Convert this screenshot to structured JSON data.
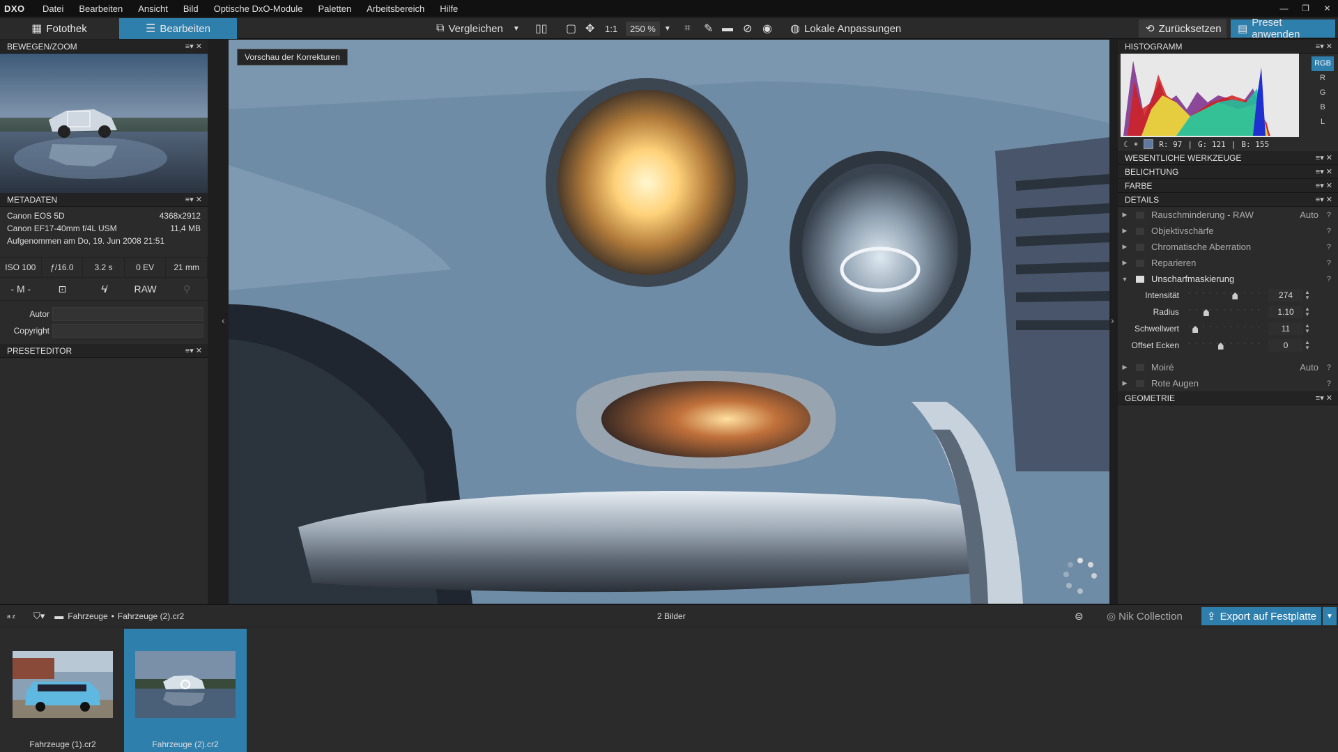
{
  "app": {
    "logo": "DXO"
  },
  "menu": [
    "Datei",
    "Bearbeiten",
    "Ansicht",
    "Bild",
    "Optische DxO-Module",
    "Paletten",
    "Arbeitsbereich",
    "Hilfe"
  ],
  "window_controls": [
    "—",
    "❐",
    "✕"
  ],
  "modes": {
    "library": "Fotothek",
    "edit": "Bearbeiten"
  },
  "toolbar": {
    "compare": "Vergleichen",
    "one_to_one": "1:1",
    "zoom": "250 %",
    "local_adjust": "Lokale Anpassungen",
    "reset": "Zurücksetzen",
    "apply_preset": "Preset anwenden"
  },
  "left_panel": {
    "nav_title": "BEWEGEN/ZOOM",
    "meta_title": "METADATEN",
    "camera": "Canon EOS 5D",
    "resolution": "4368x2912",
    "lens": "Canon EF17-40mm f/4L USM",
    "filesize": "11,4 MB",
    "taken": "Aufgenommen am Do, 19. Jun 2008 21:51",
    "exif": [
      "ISO 100",
      "ƒ/16.0",
      "3.2 s",
      "0 EV",
      "21 mm"
    ],
    "mode": "- M -",
    "raw": "RAW",
    "author_label": "Autor",
    "copyright_label": "Copyright",
    "preset_title": "PRESETEDITOR"
  },
  "viewer": {
    "preview_label": "Vorschau der Korrekturen"
  },
  "right_panel": {
    "histogram_title": "HISTOGRAMM",
    "channels": [
      "RGB",
      "R",
      "G",
      "B",
      "L"
    ],
    "readout": {
      "r": "R:  97",
      "g": "G: 121",
      "b": "B: 155",
      "sep": "|"
    },
    "sections": {
      "essential": "WESENTLICHE WERKZEUGE",
      "exposure": "BELICHTUNG",
      "color": "FARBE",
      "details": "DETAILS",
      "geometry": "GEOMETRIE"
    },
    "detail_tools": [
      {
        "label": "Rauschminderung - RAW",
        "right": "Auto"
      },
      {
        "label": "Objektivschärfe",
        "right": ""
      },
      {
        "label": "Chromatische Aberration",
        "right": ""
      },
      {
        "label": "Reparieren",
        "right": ""
      }
    ],
    "unsharp": {
      "label": "Unscharfmaskierung",
      "sliders": [
        {
          "label": "Intensität",
          "value": "274",
          "level": 0.6
        },
        {
          "label": "Radius",
          "value": "1.10",
          "level": 0.2
        },
        {
          "label": "Schwellwert",
          "value": "11",
          "level": 0.05
        },
        {
          "label": "Offset Ecken",
          "value": "0",
          "level": 0.4
        }
      ]
    },
    "after_tools": [
      {
        "label": "Moiré",
        "right": "Auto"
      },
      {
        "label": "Rote Augen",
        "right": ""
      }
    ],
    "help": "?"
  },
  "bottombar": {
    "sort": "a z",
    "path_folder": "Fahrzeuge",
    "path_file": "Fahrzeuge (2).cr2",
    "path_sep": "•",
    "count": "2 Bilder",
    "nik": "Nik Collection",
    "export": "Export auf Festplatte"
  },
  "filmstrip": [
    {
      "name": "Fahrzeuge (1).cr2",
      "selected": false
    },
    {
      "name": "Fahrzeuge (2).cr2",
      "selected": true
    }
  ],
  "colors": {
    "accent": "#2f7fad",
    "car_body": "#6f8ca6"
  }
}
